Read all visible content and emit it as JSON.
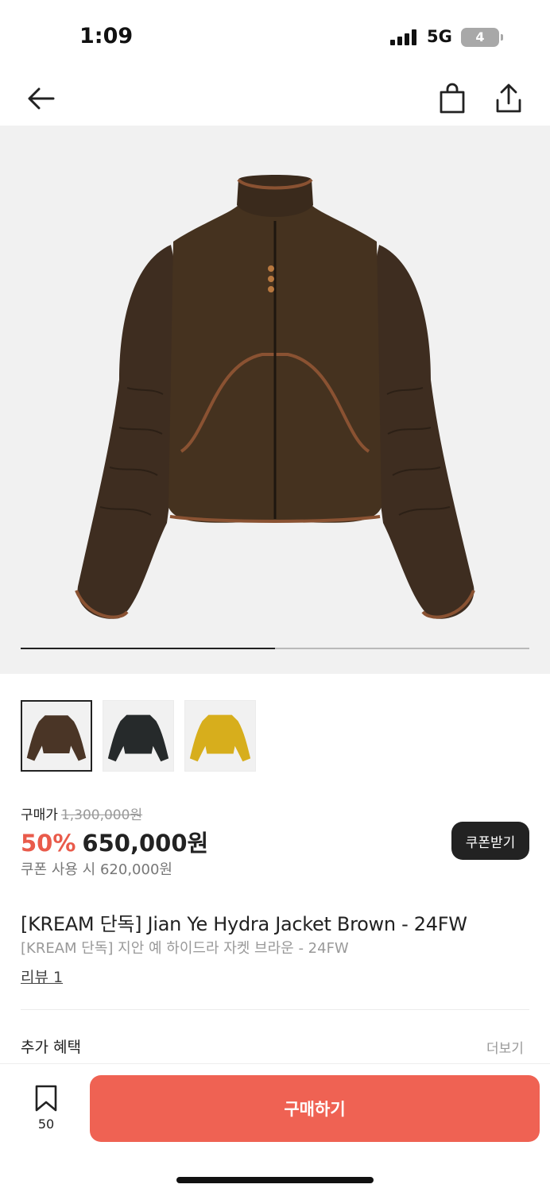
{
  "status_bar": {
    "time": "1:09",
    "network": "5G",
    "battery": "4"
  },
  "nav": {
    "icons": [
      "back-arrow-icon",
      "shopping-bag-icon",
      "share-icon"
    ]
  },
  "hero": {
    "image_progress": 0.5
  },
  "thumbnails": [
    {
      "color": "#4a3526"
    },
    {
      "color": "#262a2b"
    },
    {
      "color": "#d7ae1c"
    }
  ],
  "price": {
    "label": "구매가",
    "original": "1,300,000원",
    "discount": "50%",
    "sale": "650,000원",
    "coupon_note": "쿠폰 사용 시 620,000원",
    "coupon_button": "쿠폰받기"
  },
  "product": {
    "title_en": "[KREAM 단독] Jian Ye Hydra Jacket Brown - 24FW",
    "title_ko": "[KREAM 단독] 지안 예 하이드라 자켓 브라운 - 24FW",
    "review_link": "리뷰 1"
  },
  "benefits": {
    "label": "추가 혜택",
    "more": "더보기"
  },
  "bottom": {
    "bookmark_count": "50",
    "buy_button": "구매하기"
  },
  "colors": {
    "accent": "#ef6253",
    "discount": "#e95b4b"
  }
}
